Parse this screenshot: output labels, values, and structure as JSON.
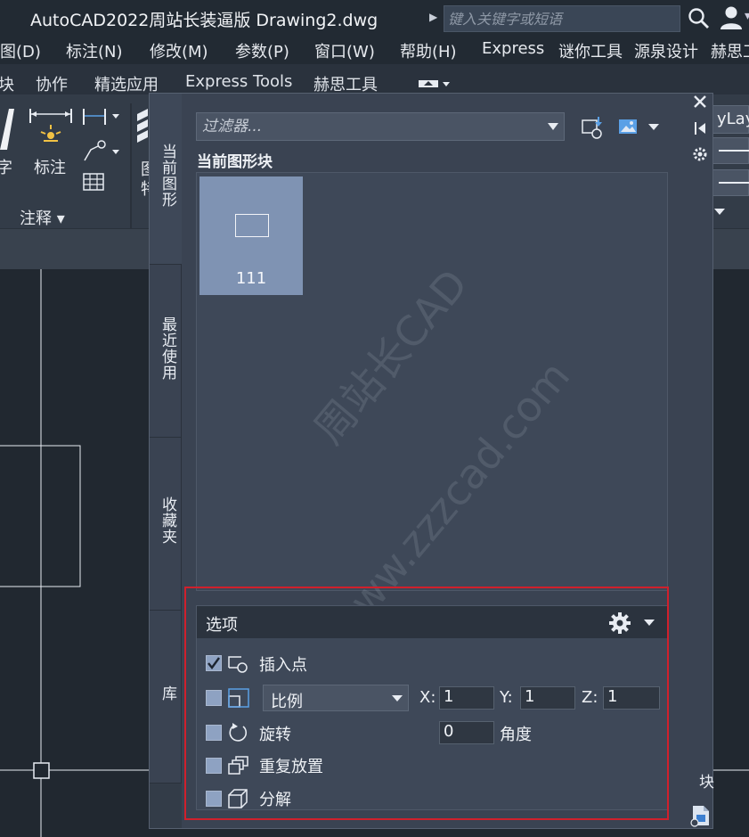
{
  "title_bar": {
    "title": "AutoCAD2022周站长装逼版    Drawing2.dwg",
    "search_placeholder": "键入关键字或短语"
  },
  "menu_bar": {
    "items": [
      "图(D)",
      "标注(N)",
      "修改(M)",
      "参数(P)",
      "窗口(W)",
      "帮助(H)",
      "Express",
      "谜你工具",
      "源泉设计",
      "赫思工"
    ]
  },
  "ribbon_tabs": {
    "items": [
      "块",
      "协作",
      "精选应用",
      "Express Tools",
      "赫思工具"
    ]
  },
  "ribbon": {
    "text_label": "字",
    "dim_label": "标注",
    "annotation_panel": "注释 ▾",
    "partial_label_1": "图",
    "partial_label_2": "特",
    "layer_value": "yLay"
  },
  "palette": {
    "tabs": [
      "当前图形",
      "最近使用",
      "收藏夹",
      "库"
    ],
    "filter_placeholder": "过滤器...",
    "current_blocks_title": "当前图形块",
    "blocks": [
      {
        "name": "111"
      }
    ],
    "watermark_1": "周站长CAD",
    "watermark_2": "www.zzzcad.com",
    "side_label": "块"
  },
  "options": {
    "title": "选项",
    "insertion_point": {
      "label": "插入点",
      "checked": true
    },
    "scale": {
      "label": "比例",
      "checked": false,
      "x_label": "X:",
      "y_label": "Y:",
      "z_label": "Z:",
      "x": "1",
      "y": "1",
      "z": "1"
    },
    "rotation": {
      "label": "旋转",
      "checked": false,
      "angle": "0",
      "angle_label": "角度"
    },
    "repeat_placement": {
      "label": "重复放置",
      "checked": false
    },
    "explode": {
      "label": "分解",
      "checked": false
    }
  },
  "colors": {
    "highlight": "#d0202c",
    "block_tile": "#7f93b3",
    "checkbox": "#8ea2c2"
  }
}
